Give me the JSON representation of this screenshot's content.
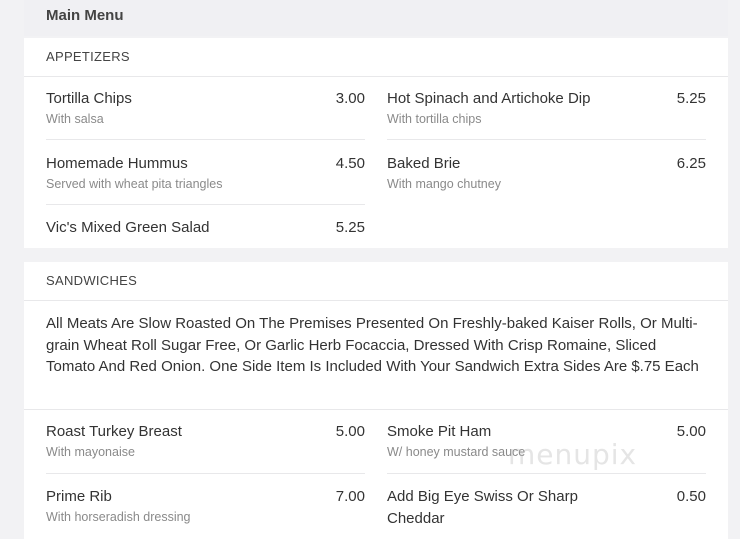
{
  "menu": {
    "title": "Main Menu"
  },
  "appetizers": {
    "title": "APPETIZERS",
    "items": [
      {
        "name": "Tortilla Chips",
        "price": "3.00",
        "desc": "With salsa"
      },
      {
        "name": "Hot Spinach and Artichoke Dip",
        "price": "5.25",
        "desc": "With tortilla chips"
      },
      {
        "name": "Homemade Hummus",
        "price": "4.50",
        "desc": "Served with wheat pita triangles"
      },
      {
        "name": "Baked Brie",
        "price": "6.25",
        "desc": "With mango chutney"
      },
      {
        "name": "Vic's Mixed Green Salad",
        "price": "5.25",
        "desc": ""
      }
    ]
  },
  "sandwiches": {
    "title": "SANDWICHES",
    "intro": "All Meats Are Slow Roasted On The Premises Presented On Freshly-baked Kaiser Rolls, Or Multi-grain Wheat Roll Sugar Free, Or Garlic Herb Focaccia, Dressed With Crisp Romaine, Sliced Tomato And Red Onion. One Side Item Is Included With Your Sandwich Extra Sides Are $.75 Each",
    "items": [
      {
        "name": "Roast Turkey Breast",
        "price": "5.00",
        "desc": "With mayonaise"
      },
      {
        "name": "Smoke Pit Ham",
        "price": "5.00",
        "desc": "W/ honey mustard sauce"
      },
      {
        "name": "Prime Rib",
        "price": "7.00",
        "desc": "With horseradish dressing"
      },
      {
        "name": "Add Big Eye Swiss Or Sharp Cheddar",
        "price": "0.50",
        "desc": ""
      }
    ]
  },
  "watermark": "menupix"
}
